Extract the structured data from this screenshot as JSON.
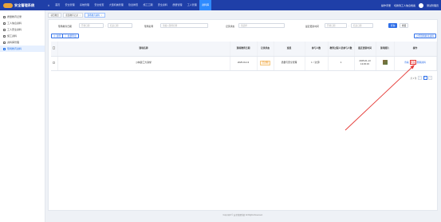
{
  "app": {
    "title": "安全管理系统"
  },
  "topnav": {
    "items": [
      "首页",
      "安全管理",
      "系统管理",
      "安全检查",
      "大型机械管理",
      "隐患排查",
      "施工工期",
      "安全资料",
      "质量管理",
      "工人管理",
      "资料库"
    ],
    "active_index": 10
  },
  "top_right": {
    "item1": "操作手册",
    "item2": "切换到工人信息档案",
    "user": "测试管理员"
  },
  "sidebar": {
    "items": [
      "质量教育记录",
      "工人信息资料",
      "工人安全资料",
      "施工资料",
      "资料库管理",
      "现场教育资料"
    ],
    "active_index": 5
  },
  "tabs": [
    "项目概览",
    "质量教育记录",
    "现场教育资料"
  ],
  "filters": {
    "date_label": "现场教育日期",
    "date_start_placeholder": "开始日期",
    "date_end_placeholder": "结束日期",
    "date_sep": "-",
    "name_label": "现场名称",
    "name_placeholder": "请输入现场名称",
    "status_label": "记录状态",
    "status_placeholder": "请选择",
    "upload_label": "最近更新时间",
    "upload_start_placeholder": "开始日期",
    "upload_end_placeholder": "结束日期",
    "search_label": "查询",
    "reset_label": "重置"
  },
  "actions": {
    "add_label": "新增",
    "export_label": "批量导出",
    "import_label": "上传现场教育资料"
  },
  "table": {
    "headers": [
      "",
      "现场名称",
      "现场教育日期",
      "记录状态",
      "班组",
      "参与人数",
      "教育过程人员参与人数",
      "最近更新时间",
      "现场照片",
      "操作"
    ],
    "rows": [
      {
        "name": "沙林建工大讲堂",
        "date": "2025-01-13",
        "status": "已过期",
        "team": "质量与安全管理",
        "count": "1（全部）",
        "participants": "1",
        "updated": "2025-01-13 13:45:15",
        "op_view": "查看",
        "op_edit": "修改",
        "op_delete": "删除资料"
      }
    ]
  },
  "pager": {
    "total": "共 1 条",
    "prev": "‹",
    "page": "1",
    "next": "›"
  },
  "footer": "Copyright © 安全管理系统 All Rights Reserved.",
  "colors": {
    "topbar": "#1f3fa8",
    "accent": "#2f6fe8",
    "highlight": "#e53935"
  }
}
